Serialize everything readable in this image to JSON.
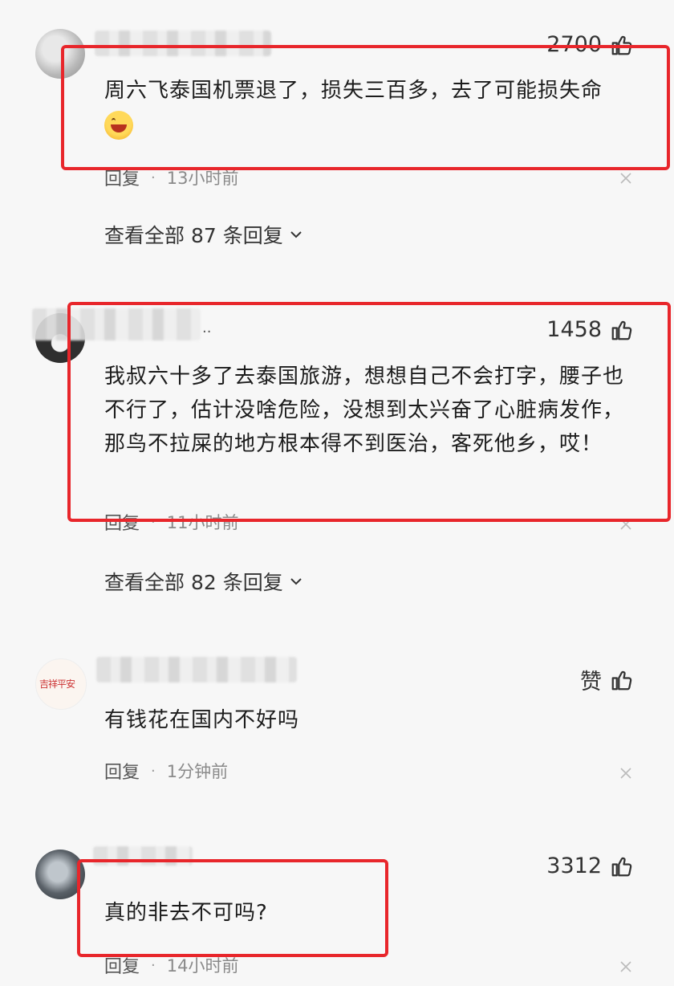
{
  "comments": [
    {
      "likes": "2700",
      "text": "周六飞泰国机票退了，损失三百多，去了可能损失命",
      "emoji": "grinning-face",
      "reply_label": "回复",
      "time": "13小时前",
      "view_all": "查看全部 87 条回复"
    },
    {
      "likes": "1458",
      "name_suffix": "..",
      "text": "我叔六十多了去泰国旅游，想想自己不会打字，腰子也不行了，估计没啥危险，没想到太兴奋了心脏病发作，那鸟不拉屎的地方根本得不到医治，客死他乡，哎！",
      "reply_label": "回复",
      "time": "11小时前",
      "view_all": "查看全部 82 条回复"
    },
    {
      "likes": "赞",
      "text": "有钱花在国内不好吗",
      "reply_label": "回复",
      "time": "1分钟前"
    },
    {
      "likes": "3312",
      "text": "真的非去不可吗?",
      "reply_label": "回复",
      "time": "14小时前"
    }
  ],
  "colors": {
    "highlight": "#e8262b",
    "background": "#f7f7f7"
  }
}
